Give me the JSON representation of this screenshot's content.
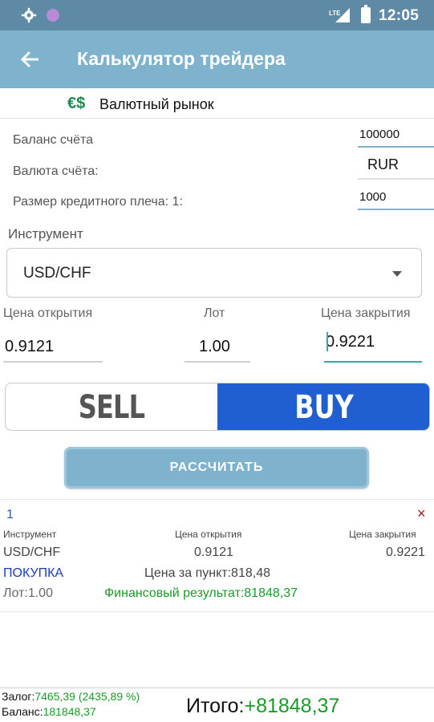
{
  "status_bar": {
    "time": "12:05",
    "network": "LTE"
  },
  "app_bar": {
    "title": "Калькулятор трейдера"
  },
  "market": {
    "symbols": "€$",
    "label": "Валютный рынок"
  },
  "account": {
    "balance_label": "Баланс счёта",
    "balance_value": "100000",
    "currency_label": "Валюта счёта:",
    "currency_value": "RUR",
    "leverage_label": "Размер кредитного плеча: 1:",
    "leverage_value": "1000"
  },
  "instrument": {
    "label": "Инструмент",
    "selected": "USD/CHF"
  },
  "trade": {
    "open_label": "Цена открытия",
    "lot_label": "Лот",
    "close_label": "Цена закрытия",
    "open_value": "0.9121",
    "lot_value": "1.00",
    "close_value": "0.9221"
  },
  "direction": {
    "sell": "SELL",
    "buy": "BUY",
    "selected": "BUY"
  },
  "calculate_button": "РАССЧИТАТЬ",
  "result": {
    "index": "1",
    "close_symbol": "×",
    "headers": [
      "Инструмент",
      "Цена открытия",
      "Цена закрытия"
    ],
    "values": [
      "USD/CHF",
      "0.9121",
      "0.9221"
    ],
    "direction": "ПОКУПКА",
    "pip_price": "Цена за пункт:818,48",
    "lot": "Лот:1.00",
    "financial_result": "Финансовый результат:81848,37"
  },
  "footer": {
    "margin_label": "Залог:",
    "margin_value": "7465,39 (2435,89 %)",
    "balance_label": "Баланс:",
    "balance_value": "181848,37",
    "total_label": "Итого:",
    "total_value": "+81848,37"
  },
  "colors": {
    "status_bar": "#5e8aa6",
    "app_bar": "#7fb2cd",
    "buy_active": "#1f5fd1",
    "positive": "#1a9a2a",
    "accent_line": "#3aa6a6"
  }
}
